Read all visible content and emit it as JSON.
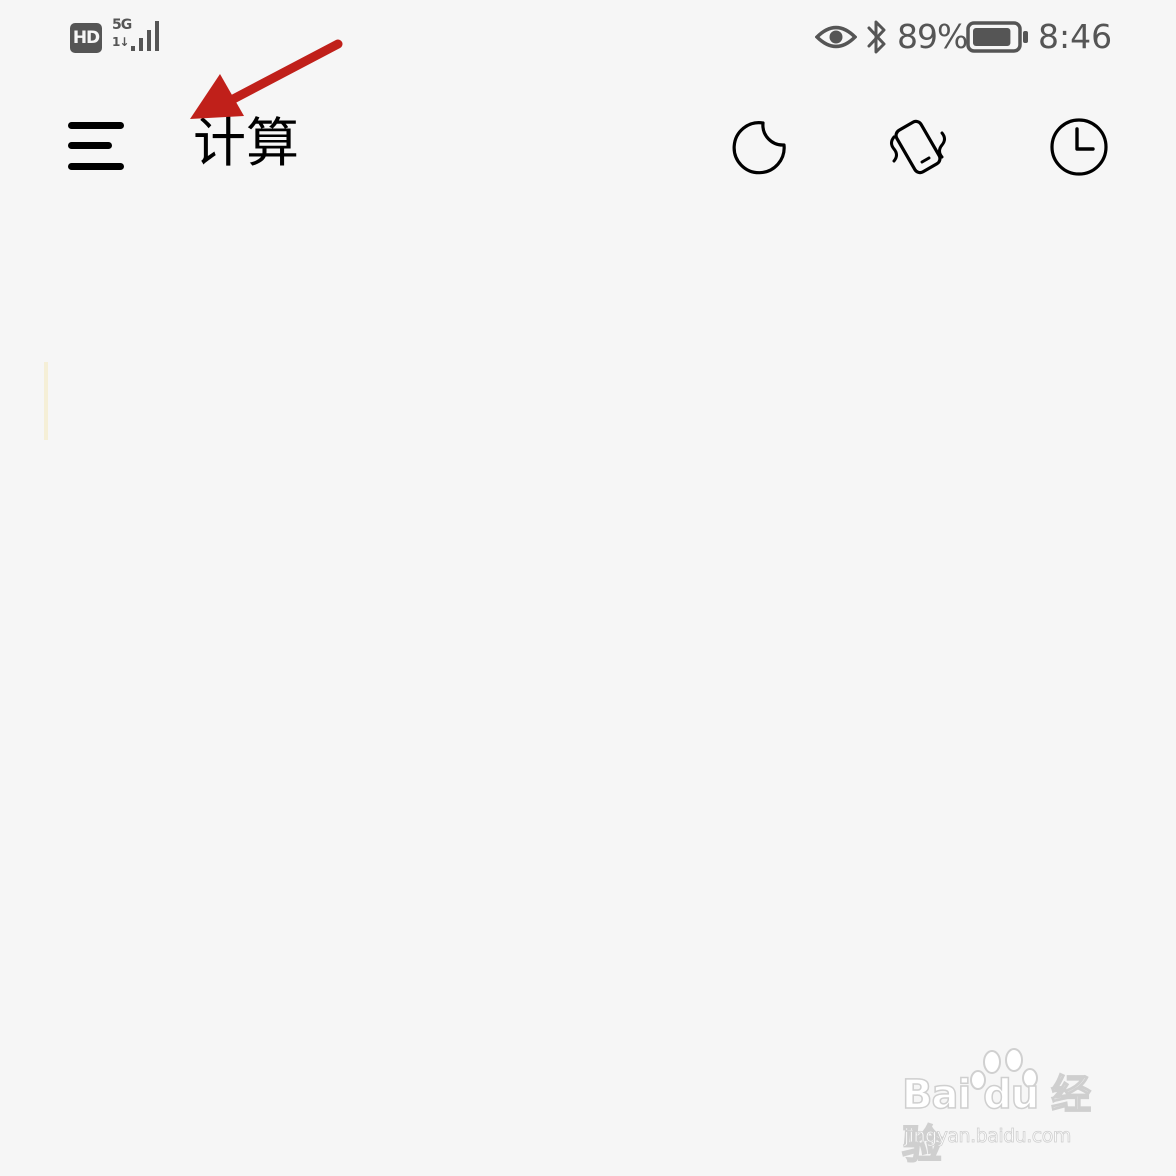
{
  "status_bar": {
    "hd_badge": "HD",
    "network_type": "5G",
    "network_arrows": "1↓",
    "battery_percent": "89%",
    "battery_level": 0.89,
    "time": "8:46",
    "icons": [
      "signal-icon",
      "eye-icon",
      "bluetooth-icon",
      "battery-icon"
    ]
  },
  "toolbar": {
    "title": "计算",
    "menu_icon": "hamburger-menu-icon",
    "actions": [
      "night-mode-icon",
      "rotate-screen-icon",
      "history-clock-icon"
    ]
  },
  "annotation": {
    "color": "#c0201a",
    "points_to": "hamburger-menu-icon"
  },
  "watermark": {
    "brand": "Bai du 经验",
    "url": "jingyan.baidu.com"
  },
  "colors": {
    "background": "#f6f6f6",
    "status_text": "#555555",
    "toolbar_text": "#000000"
  }
}
